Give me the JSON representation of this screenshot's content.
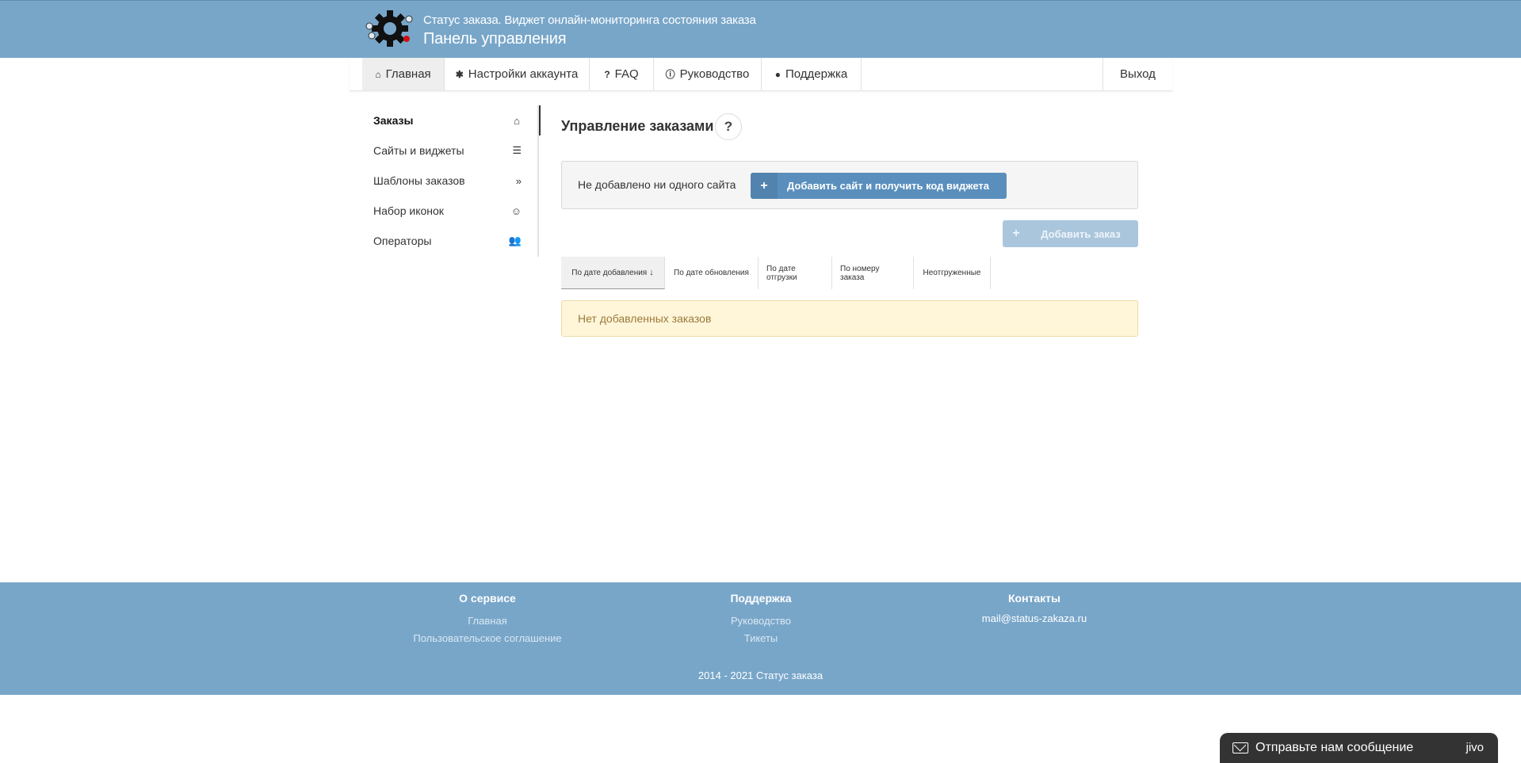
{
  "header": {
    "subtitle": "Статус заказа. Виджет онлайн-мониторинга состояния заказа",
    "title": "Панель управления"
  },
  "nav": {
    "items": [
      {
        "label": "Главная",
        "icon": "home-icon"
      },
      {
        "label": "Настройки аккаунта",
        "icon": "gear-icon"
      },
      {
        "label": "FAQ",
        "icon": "question-icon"
      },
      {
        "label": "Руководство",
        "icon": "info-icon"
      },
      {
        "label": "Поддержка",
        "icon": "user-icon"
      }
    ],
    "logout": "Выход"
  },
  "sidebar": {
    "items": [
      {
        "label": "Заказы",
        "icon": "home-icon"
      },
      {
        "label": "Сайты и виджеты",
        "icon": "list-icon"
      },
      {
        "label": "Шаблоны заказов",
        "icon": "double-chevron-icon"
      },
      {
        "label": "Набор иконок",
        "icon": "smile-icon"
      },
      {
        "label": "Операторы",
        "icon": "users-icon"
      }
    ]
  },
  "main": {
    "title": "Управление заказами",
    "help": "?",
    "no_sites_text": "Не добавлено ни одного сайта",
    "add_site_button": "Добавить сайт и получить код виджета",
    "add_order_button": "Добавить заказ",
    "tabs": [
      "По дате добавления",
      "По дате обновления",
      "По дате отгрузки",
      "По номеру заказа",
      "Неотгруженные"
    ],
    "empty_text": "Нет добавленных заказов"
  },
  "footer": {
    "about": {
      "title": "О сервисе",
      "links": [
        "Главная",
        "Пользовательское соглашение"
      ]
    },
    "support": {
      "title": "Поддержка",
      "links": [
        "Руководство",
        "Тикеты"
      ]
    },
    "contacts": {
      "title": "Контакты",
      "email": "mail@status-zakaza.ru"
    },
    "copyright": "2014 - 2021 Статус заказа"
  },
  "chat": {
    "label": "Отправьте нам сообщение",
    "brand": "jivo"
  },
  "colors": {
    "header_bg": "#78a6c9",
    "primary_button": "#5a8fbd",
    "disabled_button": "#aac6dd",
    "alert_bg": "#fff6da",
    "chat_bg": "#333333"
  }
}
